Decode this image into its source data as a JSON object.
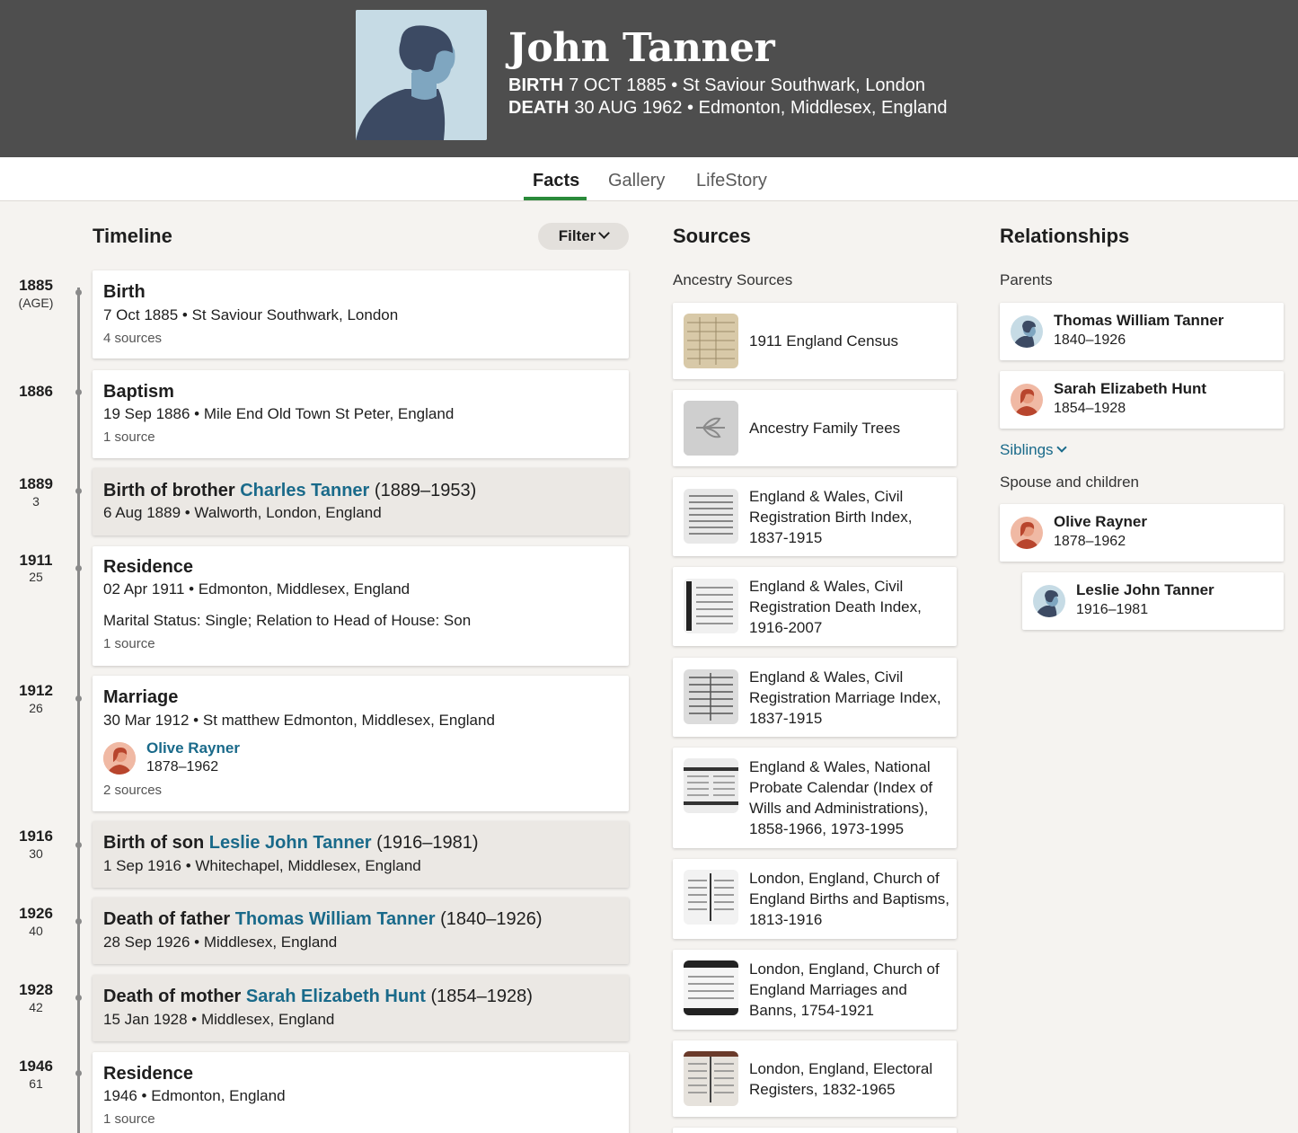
{
  "person": {
    "name": "John Tanner",
    "birth_label": "BIRTH",
    "birth_value": "7 OCT 1885 • St Saviour Southwark, London",
    "death_label": "DEATH",
    "death_value": "30 AUG 1962 • Edmonton, Middlesex, England"
  },
  "tabs": {
    "facts": "Facts",
    "gallery": "Gallery",
    "lifestory": "LifeStory",
    "active": "Facts"
  },
  "timeline": {
    "title": "Timeline",
    "filter_label": "Filter",
    "events": [
      {
        "year": "1885",
        "age": "(AGE)",
        "title": "Birth",
        "detail": "7 Oct 1885 • St Saviour Southwark, London",
        "sources": "4 sources"
      },
      {
        "year": "1886",
        "age": "",
        "title": "Baptism",
        "detail": "19 Sep 1886 • Mile End Old Town St Peter, England",
        "sources": "1 source"
      },
      {
        "year": "1889",
        "age": "3",
        "title_prefix": "Birth of brother",
        "title_link": "Charles Tanner",
        "title_suffix": "(1889–1953)",
        "detail": "6 Aug 1889 • Walworth, London, England"
      },
      {
        "year": "1911",
        "age": "25",
        "title": "Residence",
        "detail": "02 Apr 1911 • Edmonton, Middlesex, England",
        "extra": "Marital Status: Single; Relation to Head of House: Son",
        "sources": "1 source"
      },
      {
        "year": "1912",
        "age": "26",
        "title": "Marriage",
        "detail": "30 Mar 1912 • St matthew Edmonton, Middlesex, England",
        "spouse_name": "Olive Rayner",
        "spouse_dates": "1878–1962",
        "sources": "2 sources"
      },
      {
        "year": "1916",
        "age": "30",
        "title_prefix": "Birth of son",
        "title_link": "Leslie John Tanner",
        "title_suffix": "(1916–1981)",
        "detail": "1 Sep 1916 • Whitechapel, Middlesex, England"
      },
      {
        "year": "1926",
        "age": "40",
        "title_prefix": "Death of father",
        "title_link": "Thomas William Tanner",
        "title_suffix": "(1840–1926)",
        "detail": "28 Sep 1926 • Middlesex, England"
      },
      {
        "year": "1928",
        "age": "42",
        "title_prefix": "Death of mother",
        "title_link": "Sarah Elizabeth Hunt",
        "title_suffix": "(1854–1928)",
        "detail": "15 Jan 1928 • Middlesex, England"
      },
      {
        "year": "1946",
        "age": "61",
        "title": "Residence",
        "detail": "1946 • Edmonton, England",
        "sources": "1 source"
      }
    ]
  },
  "sources": {
    "title": "Sources",
    "subtitle": "Ancestry Sources",
    "items": [
      "1911 England Census",
      "Ancestry Family Trees",
      "England & Wales, Civil Registration Birth Index, 1837-1915",
      "England & Wales, Civil Registration Death Index, 1916-2007",
      "England & Wales, Civil Registration Marriage Index, 1837-1915",
      "England & Wales, National Probate Calendar (Index of Wills and Administrations), 1858-1966, 1973-1995",
      "London, England, Church of England Births and Baptisms, 1813-1916",
      "London, England, Church of England Marriages and Banns, 1754-1921",
      "London, England, Electoral Registers, 1832-1965"
    ]
  },
  "relationships": {
    "title": "Relationships",
    "parents_label": "Parents",
    "parents": [
      {
        "name": "Thomas William Tanner",
        "dates": "1840–1926"
      },
      {
        "name": "Sarah Elizabeth Hunt",
        "dates": "1854–1928"
      }
    ],
    "siblings_label": "Siblings",
    "spouse_label": "Spouse and children",
    "spouse": {
      "name": "Olive Rayner",
      "dates": "1878–1962"
    },
    "children": [
      {
        "name": "Leslie John Tanner",
        "dates": "1916–1981"
      }
    ]
  },
  "colors": {
    "header_bg": "#4e4e4e",
    "link": "#1a6a8a",
    "tab_accent": "#2a8a3a",
    "page_bg": "#f5f3f0"
  }
}
